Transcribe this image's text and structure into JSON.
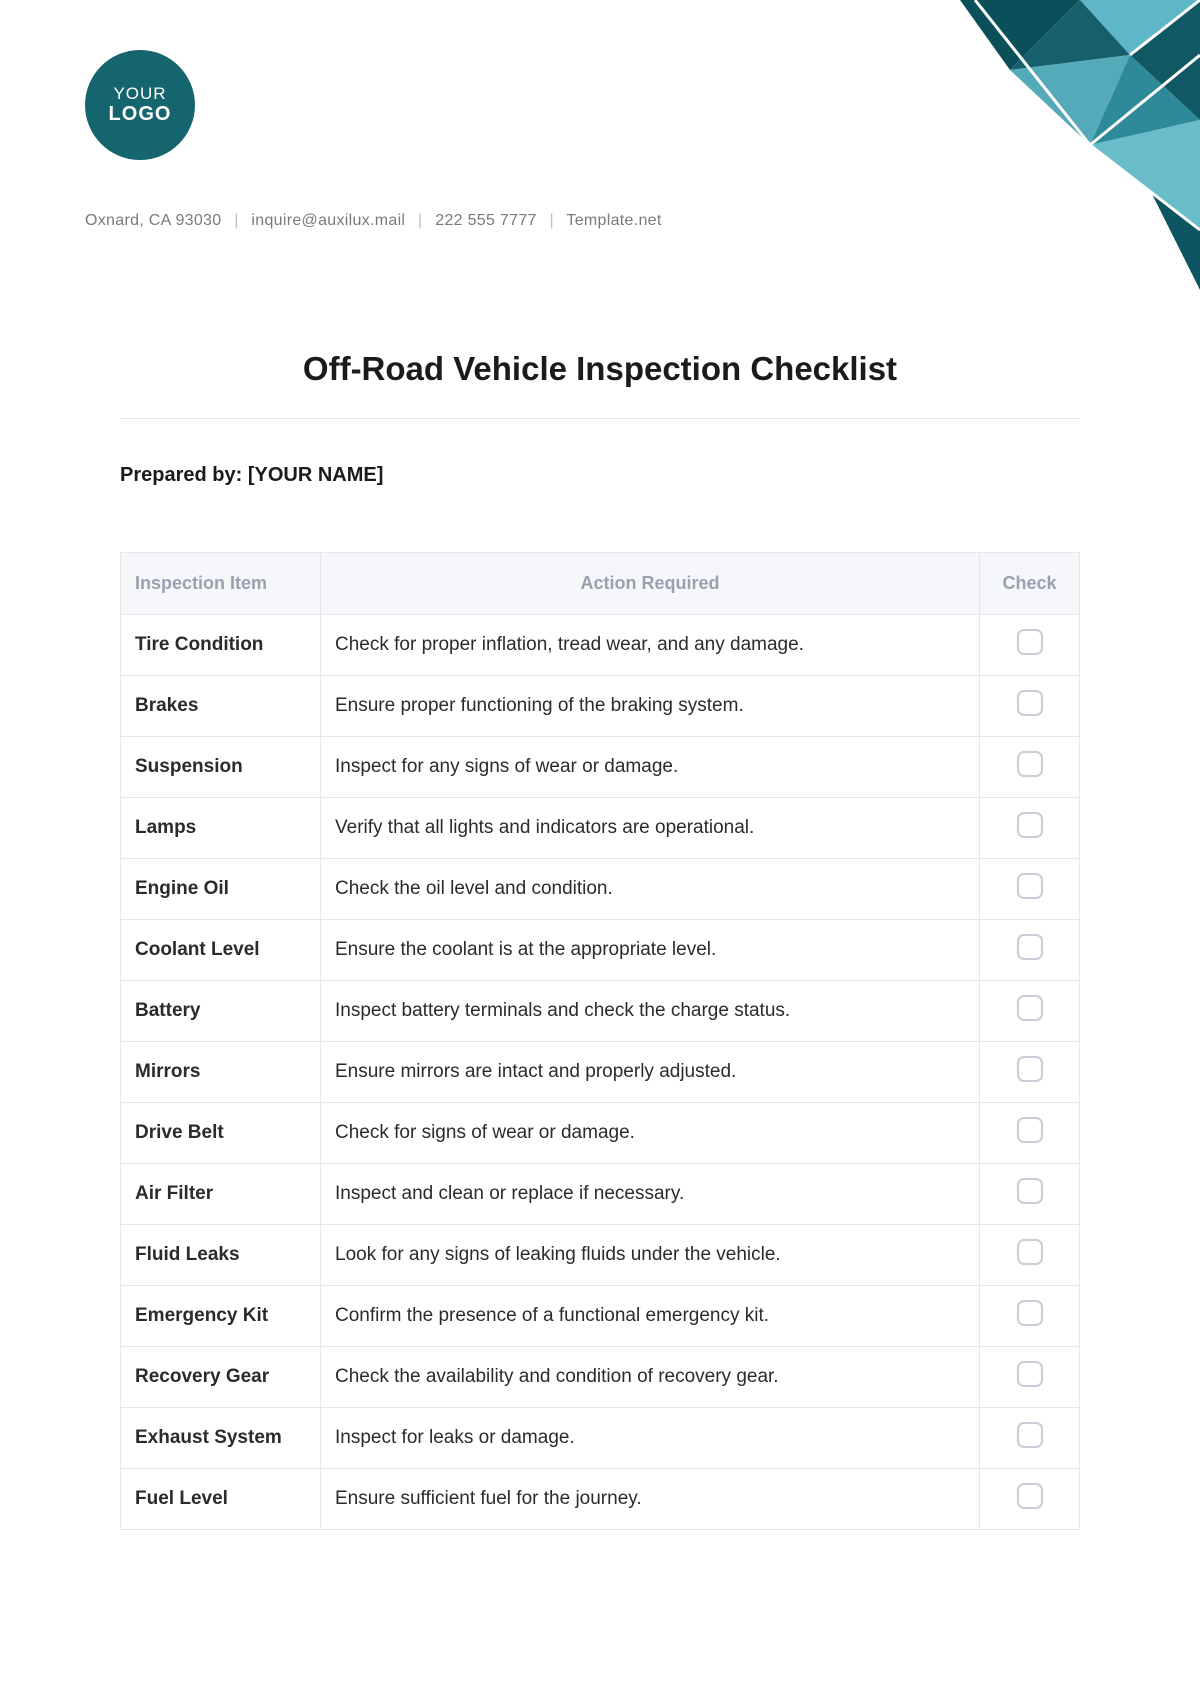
{
  "logo": {
    "line1": "YOUR",
    "line2": "LOGO"
  },
  "contact": {
    "address": "Oxnard, CA 93030",
    "email": "inquire@auxilux.mail",
    "phone": "222 555 7777",
    "site": "Template.net"
  },
  "title": "Off-Road Vehicle Inspection Checklist",
  "prepared_by_label": "Prepared by: [YOUR NAME]",
  "table": {
    "headers": {
      "item": "Inspection Item",
      "action": "Action Required",
      "check": "Check"
    },
    "rows": [
      {
        "item": "Tire Condition",
        "action": "Check for proper inflation, tread wear, and any damage."
      },
      {
        "item": "Brakes",
        "action": "Ensure proper functioning of the braking system."
      },
      {
        "item": "Suspension",
        "action": "Inspect for any signs of wear or damage."
      },
      {
        "item": "Lamps",
        "action": "Verify that all lights and indicators are operational."
      },
      {
        "item": "Engine Oil",
        "action": "Check the oil level and condition."
      },
      {
        "item": "Coolant Level",
        "action": "Ensure the coolant is at the appropriate level."
      },
      {
        "item": "Battery",
        "action": "Inspect battery terminals and check the charge status."
      },
      {
        "item": "Mirrors",
        "action": "Ensure mirrors are intact and properly adjusted."
      },
      {
        "item": "Drive Belt",
        "action": "Check for signs of wear or damage."
      },
      {
        "item": "Air Filter",
        "action": "Inspect and clean or replace if necessary."
      },
      {
        "item": "Fluid Leaks",
        "action": "Look for any signs of leaking fluids under the vehicle."
      },
      {
        "item": "Emergency Kit",
        "action": "Confirm the presence of a functional emergency kit."
      },
      {
        "item": "Recovery Gear",
        "action": "Check the availability and condition of recovery gear."
      },
      {
        "item": "Exhaust System",
        "action": "Inspect for leaks or damage."
      },
      {
        "item": "Fuel Level",
        "action": "Ensure sufficient fuel for the journey."
      }
    ]
  }
}
